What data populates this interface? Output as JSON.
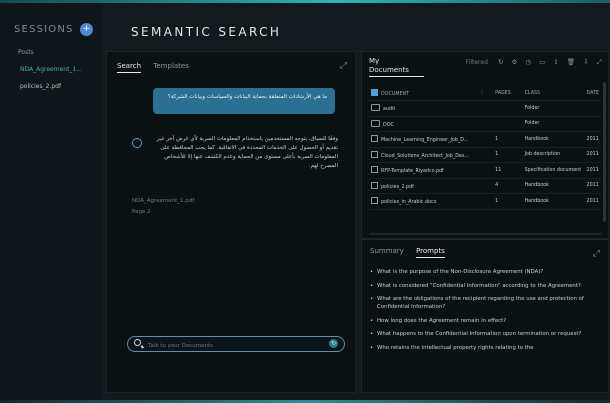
{
  "sidebar": {
    "title": "SESSIONS",
    "badge": "+",
    "folder": "Posts",
    "items": [
      {
        "label": "NDA_Agreement_1..."
      },
      {
        "label": "policies_2.pdf"
      }
    ]
  },
  "main": {
    "title": "SEMANTIC SEARCH"
  },
  "chat": {
    "tabs": [
      {
        "label": "Search"
      },
      {
        "label": "Templates"
      }
    ],
    "user_message": "ما هي الأرشادات المتعلقة بحماية البيانات والسياسات وبيانات الشركة؟",
    "bot_message": "وفقًا للسياق، يتوجه المستخدمين باستخدام المعلومات السرية لأي غرض آخر غير تقديم أو الحصول على الخدمات المحددة في الاتفاقية. كما يجب المحافظة على المعلومات السرية بأعلى مستوى من الحماية وعدم الكشف عنها إلا للأشخاص المصرح لهم.",
    "source": "NDA_Agreement_1.pdf",
    "page": "Page 2",
    "search_placeholder": "Talk to your Documents"
  },
  "documents": {
    "title_line1": "My",
    "title_line2": "Documents",
    "filter_label": "Filtered",
    "columns": [
      "DOCUMENT",
      "PAGES",
      "CLASS",
      "DATE"
    ],
    "rows": [
      {
        "name": "audit",
        "type": "folder",
        "pages": "",
        "class": "Folder",
        "date": ""
      },
      {
        "name": "DOC",
        "type": "folder",
        "pages": "",
        "class": "Folder",
        "date": ""
      },
      {
        "name": "Machine_Learning_Engineer_Job_D...",
        "type": "file",
        "pages": "1",
        "class": "Handbook",
        "date": "2011"
      },
      {
        "name": "Cloud_Solutions_Architect_Job_Des...",
        "type": "file",
        "pages": "1",
        "class": "Job description",
        "date": "2011"
      },
      {
        "name": "RFP-Template_Riyadco.pdf",
        "type": "file",
        "pages": "11",
        "class": "Specification document",
        "date": "2011"
      },
      {
        "name": "policies_2.pdf",
        "type": "file",
        "pages": "4",
        "class": "Handbook",
        "date": "2011"
      },
      {
        "name": "policies_in_Arabic.docx",
        "type": "file",
        "pages": "1",
        "class": "Handbook",
        "date": "2011"
      }
    ]
  },
  "prompts": {
    "tabs": [
      {
        "label": "Summary"
      },
      {
        "label": "Prompts"
      }
    ],
    "items": [
      "What is the purpose of the Non-Disclosure Agreement (NDA)?",
      "What is considered \"Confidential Information\" according to the Agreement?",
      "What are the obligations of the recipient regarding the use and protection of Confidential Information?",
      "How long does the Agreement remain in effect?",
      "What happens to the Confidential Information upon termination or request?",
      "Who retains the intellectual property rights relating to the"
    ]
  }
}
